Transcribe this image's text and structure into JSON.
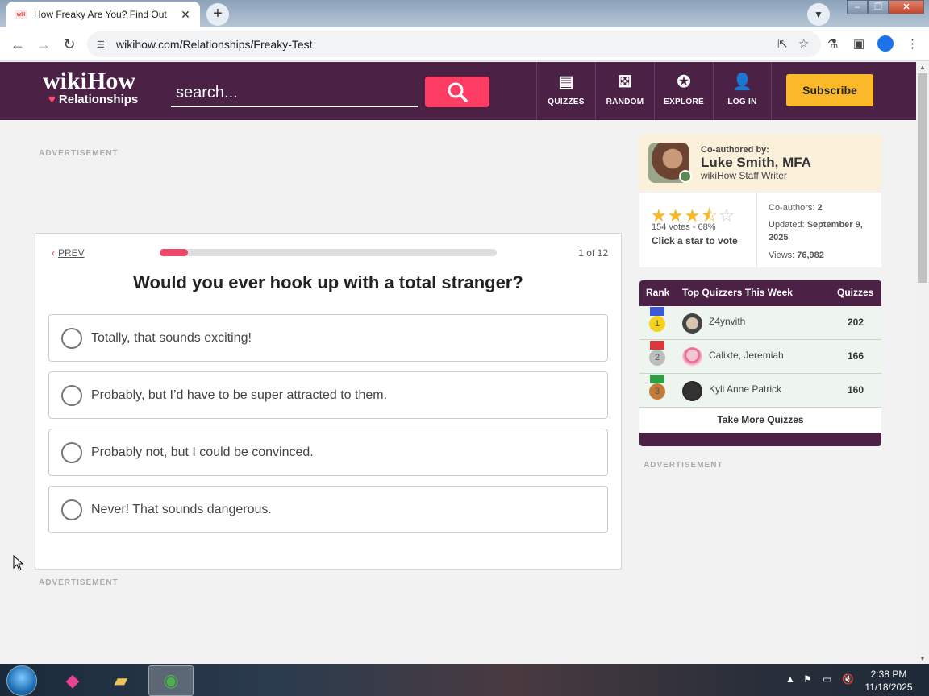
{
  "browser": {
    "tab_title": "How Freaky Are You? Find Out",
    "tab_favicon": "wH",
    "url": "wikihow.com/Relationships/Freaky-Test"
  },
  "site": {
    "logo": "wikiHow",
    "logo_sub": "Relationships",
    "search_placeholder": "search...",
    "nav": [
      "QUIZZES",
      "RANDOM",
      "EXPLORE",
      "LOG IN"
    ],
    "subscribe_label": "Subscribe",
    "brand_color": "#4b2146",
    "accent_color": "#ff3d64"
  },
  "ads": {
    "label": "ADVERTISEMENT"
  },
  "quiz": {
    "prev_label": "PREV",
    "progress_fraction": 0.083,
    "counter": "1 of 12",
    "question": "Would you ever hook up with a total stranger?",
    "options": [
      "Totally, that sounds exciting!",
      "Probably, but I’d have to be super attracted to them.",
      "Probably not, but I could be convinced.",
      "Never! That sounds dangerous."
    ]
  },
  "author": {
    "coauthored_label": "Co-authored by:",
    "name": "Luke Smith, MFA",
    "role": "wikiHow Staff Writer"
  },
  "rating": {
    "stars": 3.5,
    "votes_text": "154 votes - 68%",
    "cta": "Click a star to vote",
    "coauthors_label": "Co-authors:",
    "coauthors": "2",
    "updated_label": "Updated:",
    "updated": "September 9, 2025",
    "views_label": "Views:",
    "views": "76,982"
  },
  "leaderboard": {
    "headers": [
      "Rank",
      "Top Quizzers This Week",
      "Quizzes"
    ],
    "rows": [
      {
        "rank": "1",
        "name": "Z4ynvith",
        "score": "202"
      },
      {
        "rank": "2",
        "name": "Calixte, Jeremiah",
        "score": "166"
      },
      {
        "rank": "3",
        "name": "Kyli Anne Patrick",
        "score": "160"
      }
    ],
    "more_label": "Take More Quizzes"
  },
  "taskbar": {
    "time": "2:38 PM",
    "date": "11/18/2025"
  }
}
